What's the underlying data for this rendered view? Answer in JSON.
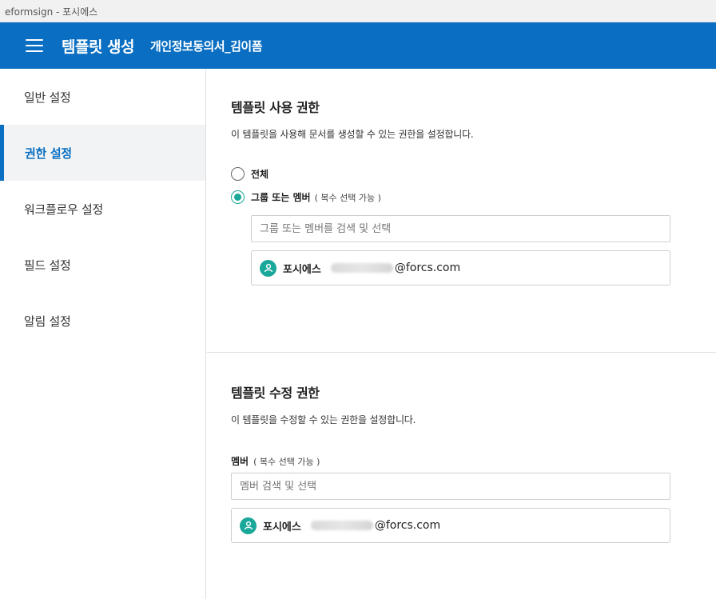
{
  "window": {
    "title": "eformsign - 포시에스"
  },
  "header": {
    "app_title": "템플릿 생성",
    "doc_title": "개인정보동의서_김이폼"
  },
  "sidebar": {
    "items": [
      {
        "label": "일반 설정"
      },
      {
        "label": "권한 설정"
      },
      {
        "label": "워크플로우 설정"
      },
      {
        "label": "필드 설정"
      },
      {
        "label": "알림 설정"
      }
    ],
    "active_index": 1
  },
  "usage_permission": {
    "title": "템플릿 사용 권한",
    "description": "이 템플릿을 사용해 문서를 생성할 수 있는 권한을 설정합니다.",
    "options": [
      {
        "label": "전체",
        "sub": "",
        "checked": false
      },
      {
        "label": "그룹 또는 멤버",
        "sub": "( 복수 선택 가능 )",
        "checked": true
      }
    ],
    "search_placeholder": "그룹 또는 멤버를 검색 및 선택",
    "selected": {
      "name": "포시에스",
      "email_domain": "@forcs.com"
    }
  },
  "edit_permission": {
    "title": "템플릿 수정 권한",
    "description": "이 템플릿을 수정할 수 있는 권한을 설정합니다.",
    "field_label": "멤버",
    "field_sub": "( 복수 선택 가능 )",
    "search_placeholder": "멤버 검색 및 선택",
    "selected": {
      "name": "포시에스",
      "email_domain": "@forcs.com"
    }
  },
  "colors": {
    "primary": "#0a6fc2",
    "accent": "#1aa89a"
  }
}
